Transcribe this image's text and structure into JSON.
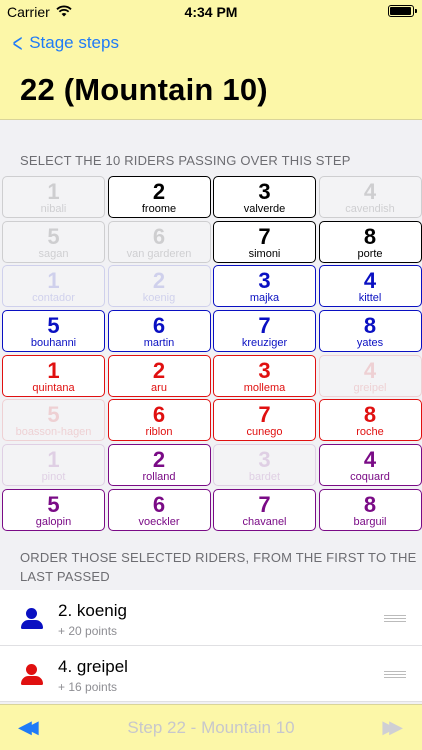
{
  "status_bar": {
    "carrier": "Carrier",
    "time": "4:34 PM",
    "battery_level": 1.0
  },
  "nav": {
    "back_label": "Stage steps",
    "title": "22 (Mountain 10)"
  },
  "select_header": "SELECT THE 10 RIDERS PASSING OVER THIS STEP",
  "colors": {
    "black": "#000000",
    "blue": "#0a10c2",
    "red": "#e01010",
    "purple": "#7a0b86",
    "accent": "#1f7bf7",
    "bar": "#fcf7a8"
  },
  "riders": [
    {
      "num": "1",
      "name": "nibali",
      "color": "black",
      "selected": false
    },
    {
      "num": "2",
      "name": "froome",
      "color": "black",
      "selected": true
    },
    {
      "num": "3",
      "name": "valverde",
      "color": "black",
      "selected": true
    },
    {
      "num": "4",
      "name": "cavendish",
      "color": "black",
      "selected": false
    },
    {
      "num": "5",
      "name": "sagan",
      "color": "black",
      "selected": false
    },
    {
      "num": "6",
      "name": "van garderen",
      "color": "black",
      "selected": false
    },
    {
      "num": "7",
      "name": "simoni",
      "color": "black",
      "selected": true
    },
    {
      "num": "8",
      "name": "porte",
      "color": "black",
      "selected": true
    },
    {
      "num": "1",
      "name": "contador",
      "color": "blue",
      "selected": false
    },
    {
      "num": "2",
      "name": "koenig",
      "color": "blue",
      "selected": false
    },
    {
      "num": "3",
      "name": "majka",
      "color": "blue",
      "selected": true
    },
    {
      "num": "4",
      "name": "kittel",
      "color": "blue",
      "selected": true
    },
    {
      "num": "5",
      "name": "bouhanni",
      "color": "blue",
      "selected": true
    },
    {
      "num": "6",
      "name": "martin",
      "color": "blue",
      "selected": true
    },
    {
      "num": "7",
      "name": "kreuziger",
      "color": "blue",
      "selected": true
    },
    {
      "num": "8",
      "name": "yates",
      "color": "blue",
      "selected": true
    },
    {
      "num": "1",
      "name": "quintana",
      "color": "red",
      "selected": true
    },
    {
      "num": "2",
      "name": "aru",
      "color": "red",
      "selected": true
    },
    {
      "num": "3",
      "name": "mollema",
      "color": "red",
      "selected": true
    },
    {
      "num": "4",
      "name": "greipel",
      "color": "red",
      "selected": false
    },
    {
      "num": "5",
      "name": "boasson-hagen",
      "color": "red",
      "selected": false
    },
    {
      "num": "6",
      "name": "riblon",
      "color": "red",
      "selected": true
    },
    {
      "num": "7",
      "name": "cunego",
      "color": "red",
      "selected": true
    },
    {
      "num": "8",
      "name": "roche",
      "color": "red",
      "selected": true
    },
    {
      "num": "1",
      "name": "pinot",
      "color": "purple",
      "selected": false
    },
    {
      "num": "2",
      "name": "rolland",
      "color": "purple",
      "selected": true
    },
    {
      "num": "3",
      "name": "bardet",
      "color": "purple",
      "selected": false
    },
    {
      "num": "4",
      "name": "coquard",
      "color": "purple",
      "selected": true
    },
    {
      "num": "5",
      "name": "galopin",
      "color": "purple",
      "selected": true
    },
    {
      "num": "6",
      "name": "voeckler",
      "color": "purple",
      "selected": true
    },
    {
      "num": "7",
      "name": "chavanel",
      "color": "purple",
      "selected": true
    },
    {
      "num": "8",
      "name": "barguil",
      "color": "purple",
      "selected": true
    }
  ],
  "order_header_line1": "ORDER THOSE SELECTED RIDERS, FROM THE FIRST TO THE",
  "order_header_line2": "LAST PASSED",
  "ordered": [
    {
      "name": "2. koenig",
      "points": "+ 20 points",
      "color": "blue",
      "icon": "person-icon"
    },
    {
      "name": "4. greipel",
      "points": "+ 16 points",
      "color": "red",
      "icon": "person-icon"
    }
  ],
  "toolbar": {
    "prev_icon": "rewind-icon",
    "step_label": "Step 22 - Mountain 10",
    "next_icon": "fast-forward-icon"
  }
}
